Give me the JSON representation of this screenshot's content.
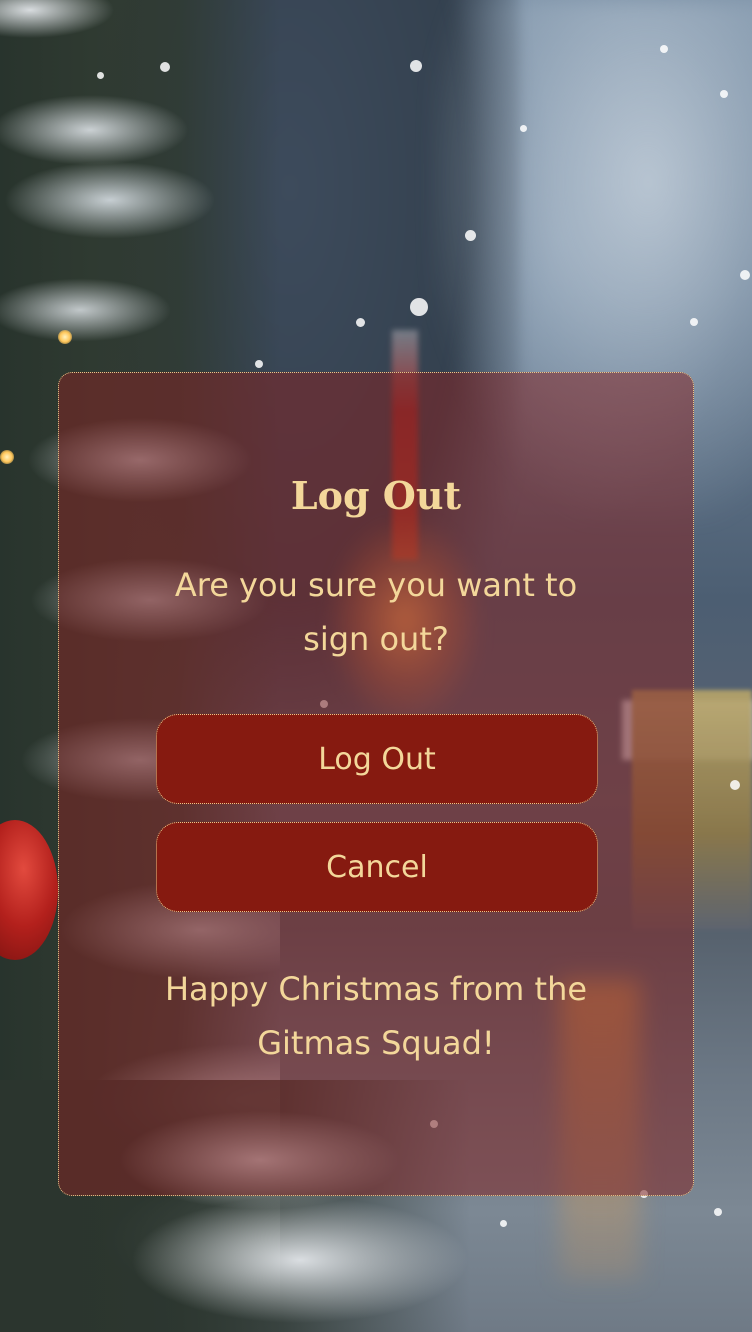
{
  "dialog": {
    "title": "Log Out",
    "message": "Are you sure you want to sign out?",
    "confirm_label": "Log Out",
    "cancel_label": "Cancel",
    "footer": "Happy Christmas from the Gitmas Squad!"
  },
  "colors": {
    "text_gold": "#f3d79a",
    "button_red": "#861a10",
    "card_overlay": "#802424",
    "border_gold": "#e7c98a"
  }
}
